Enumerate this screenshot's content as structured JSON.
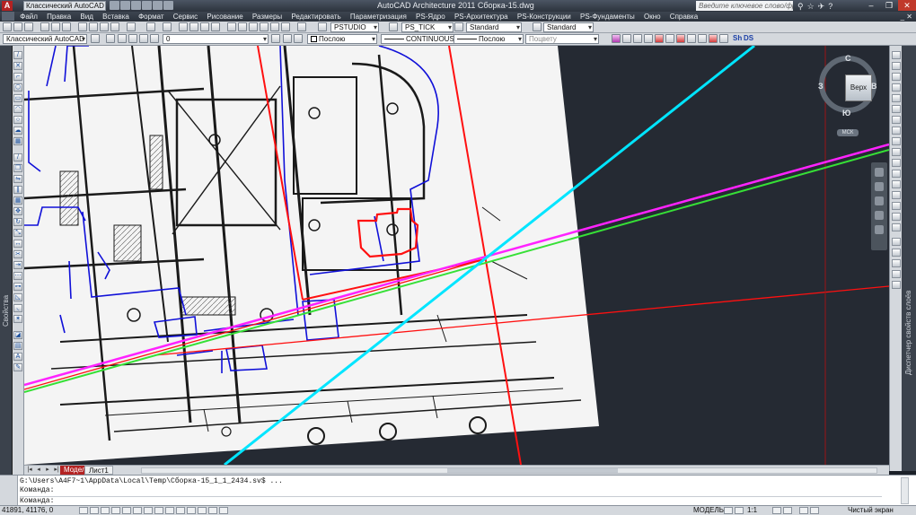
{
  "titlebar": {
    "app_letter": "A",
    "workspace": "Классический AutoCAD",
    "title": "AutoCAD Architecture 2011    Сборка-15.dwg",
    "search_placeholder": "Введите ключевое слово/фразу",
    "window_buttons": [
      "–",
      "❐",
      "✕"
    ]
  },
  "menu": {
    "items": [
      "Файл",
      "Правка",
      "Вид",
      "Вставка",
      "Формат",
      "Сервис",
      "Рисование",
      "Размеры",
      "Редактировать",
      "Параметризация",
      "PS-Ядро",
      "PS-Архитектура",
      "PS-Конструкции",
      "PS-Фундаменты",
      "Окно",
      "Справка"
    ],
    "right": "_ ✕"
  },
  "toolbar1": {
    "style_pstudio": "PSTUDIO",
    "style_tick": "PS_TICK",
    "text_style": "Standard",
    "dim_style": "Standard"
  },
  "toolbar2": {
    "workspace": "Классический AutoCAD",
    "layer": "0",
    "color": "Послою",
    "linetype": "CONTINUOUS",
    "lineweight": "Послою",
    "plotstyle": "Поцвету",
    "sh_label": "Sh",
    "ds_label": "DS"
  },
  "side_labels": {
    "left": "Свойства",
    "right": "Диспетчер свойств слоёв"
  },
  "viewcube": {
    "top_face": "Верх",
    "north": "С",
    "south": "Ю",
    "west": "З",
    "east": "В",
    "wcs": "МСК"
  },
  "layout_tabs": {
    "model": "Модель",
    "sheet": "Лист1"
  },
  "command": {
    "line1": "G:\\Users\\A4F7~1\\AppData\\Local\\Temp\\Сборка-15_1_1_2434.sv$ ...",
    "line2": "Команда:",
    "line3": "Команда:"
  },
  "status": {
    "coords": "41891, 41176, 0",
    "model": "МОДЕЛЬ",
    "scale": "1:1",
    "right": "Чистый экран"
  },
  "colors": {
    "canvas_bg": "#252a33",
    "red": "#ff1010",
    "cyan": "#00e5ff",
    "magenta": "#ff22ff",
    "green": "#36e036",
    "blue": "#1010d8"
  }
}
